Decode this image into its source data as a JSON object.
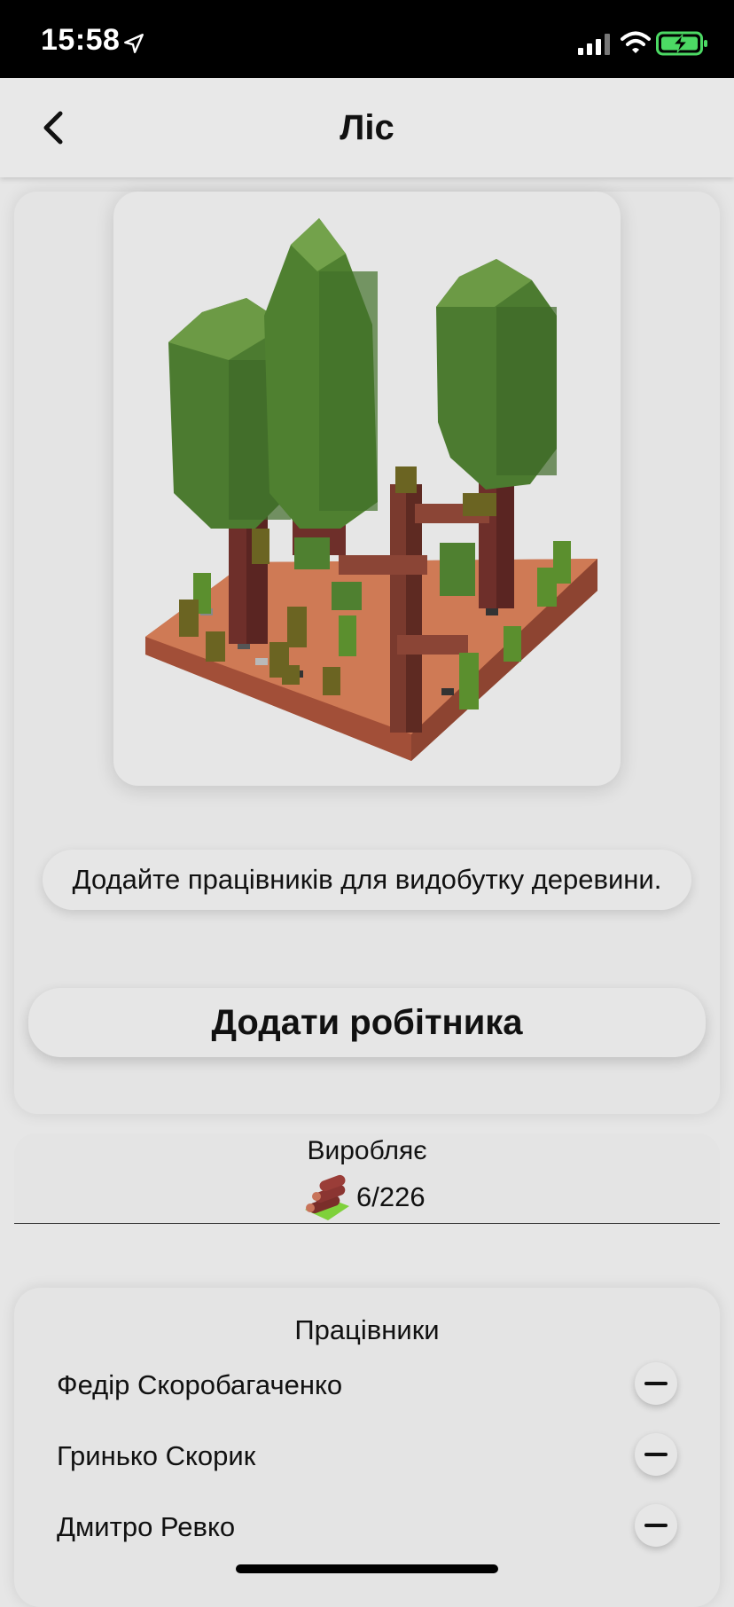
{
  "status_bar": {
    "time": "15:58"
  },
  "navbar": {
    "title": "Ліс"
  },
  "hint": {
    "text": "Додайте працівників для видобутку деревини."
  },
  "actions": {
    "add_worker_label": "Додати робітника"
  },
  "production": {
    "title": "Виробляє",
    "value": "6/226",
    "icon": "logs-icon"
  },
  "workers": {
    "title": "Працівники",
    "items": [
      {
        "name": "Федір Скоробагаченко"
      },
      {
        "name": "Гринько Скорик"
      },
      {
        "name": "Дмитро Ревко"
      }
    ]
  },
  "colors": {
    "background": "#e6e6e6",
    "tree_green": "#5a8a3a",
    "soil": "#c8714e",
    "trunk": "#7a3a2e"
  }
}
